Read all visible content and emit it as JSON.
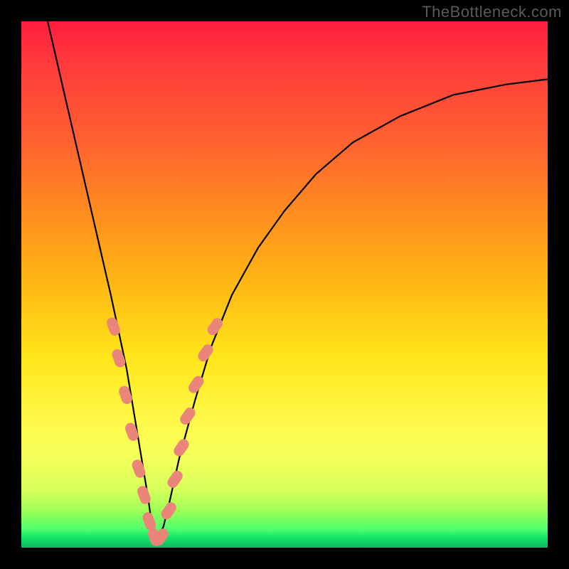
{
  "watermark": "TheBottleneck.com",
  "chart_data": {
    "type": "line",
    "title": "",
    "xlabel": "",
    "ylabel": "",
    "xlim": [
      0,
      100
    ],
    "ylim": [
      0,
      100
    ],
    "grid": false,
    "legend": false,
    "description": "Bottleneck-style V-shaped curve over rainbow gradient background (red=high bottleneck at top, green=optimal near bottom). Minimum around x≈25.",
    "series": [
      {
        "name": "bottleneck-curve",
        "x": [
          5,
          8,
          11,
          14,
          17,
          20,
          22,
          24,
          25,
          26,
          27,
          28,
          30,
          33,
          36,
          40,
          45,
          50,
          56,
          63,
          72,
          82,
          92,
          100
        ],
        "y": [
          100,
          87,
          74,
          61,
          48,
          34,
          22,
          10,
          3,
          2,
          4,
          8,
          17,
          28,
          38,
          48,
          57,
          64,
          71,
          77,
          82,
          86,
          88,
          89
        ]
      }
    ],
    "markers": {
      "name": "highlight-dots",
      "color": "#e98679",
      "points": [
        {
          "x": 17.5,
          "y": 42
        },
        {
          "x": 18.5,
          "y": 36
        },
        {
          "x": 19.8,
          "y": 29
        },
        {
          "x": 21.0,
          "y": 22
        },
        {
          "x": 22.3,
          "y": 15
        },
        {
          "x": 23.3,
          "y": 10
        },
        {
          "x": 24.3,
          "y": 5
        },
        {
          "x": 25.3,
          "y": 2
        },
        {
          "x": 26.5,
          "y": 2
        },
        {
          "x": 28.0,
          "y": 7
        },
        {
          "x": 29.2,
          "y": 13
        },
        {
          "x": 30.4,
          "y": 19
        },
        {
          "x": 31.6,
          "y": 25
        },
        {
          "x": 33.2,
          "y": 31
        },
        {
          "x": 35.0,
          "y": 37
        },
        {
          "x": 36.8,
          "y": 42
        }
      ]
    }
  }
}
